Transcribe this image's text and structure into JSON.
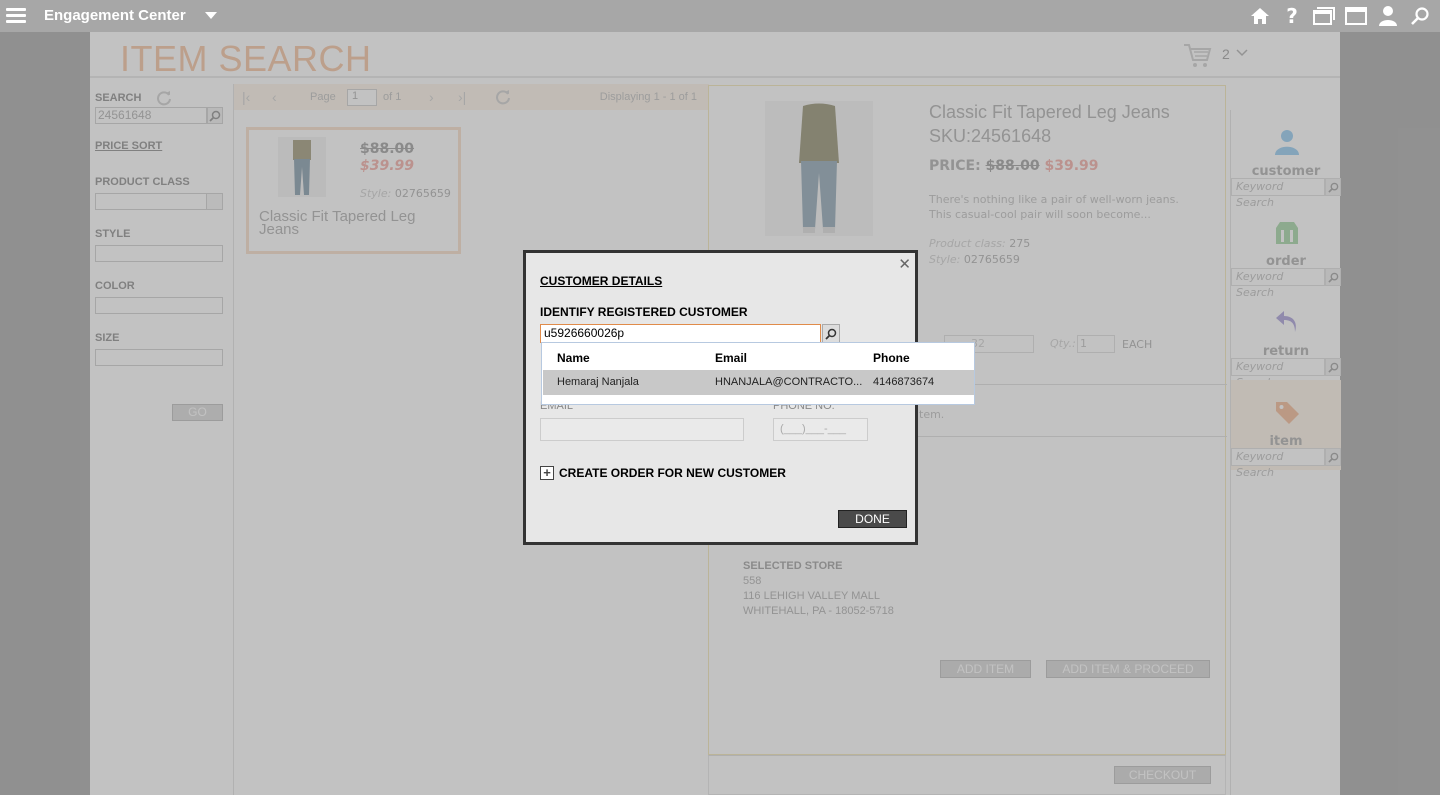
{
  "app": {
    "title": "Engagement Center"
  },
  "page": {
    "title": "ITEM SEARCH",
    "cart_count": "2"
  },
  "filters": {
    "search_label": "SEARCH",
    "search_value": "24561648",
    "price_sort": "PRICE SORT",
    "product_class_label": "PRODUCT CLASS",
    "style_label": "STYLE",
    "color_label": "COLOR",
    "size_label": "SIZE",
    "go": "GO"
  },
  "pager": {
    "page_label": "Page",
    "page_value": "1",
    "of": "of 1",
    "displaying": "Displaying 1 - 1 of 1"
  },
  "product_card": {
    "old_price": "$88.00",
    "new_price": "$39.99",
    "style_label": "Style:",
    "style_value": "02765659",
    "name": "Classic Fit Tapered Leg Jeans"
  },
  "detail": {
    "title": "Classic Fit Tapered Leg Jeans",
    "sku": "SKU:24561648",
    "price_label": "PRICE:",
    "old_price": "$88.00",
    "new_price": "$39.99",
    "description": "There's nothing like a pair of well-worn jeans. This casual-cool pair will soon become...",
    "product_class_label": "Product class:",
    "product_class_value": "275",
    "style_label": "Style:",
    "style_value": "02765659",
    "size_value": "32",
    "qty_label": "Qty.:",
    "qty_value": "1",
    "unit": "EACH",
    "ship_note": "tem.",
    "store_label": "SELECTED STORE",
    "store_number": "558",
    "store_address": "116 LEHIGH VALLEY MALL",
    "store_city": "WHITEHALL, PA - 18052-5718",
    "add_item": "ADD ITEM",
    "add_item_proceed": "ADD ITEM & PROCEED",
    "checkout": "CHECKOUT"
  },
  "right_sidebar": [
    {
      "label": "customer",
      "placeholder": "Keyword Search",
      "icon": "person-icon",
      "color": "#8fc8f0"
    },
    {
      "label": "order",
      "placeholder": "Keyword Search",
      "icon": "order-icon",
      "color": "#9fd4a0"
    },
    {
      "label": "return",
      "placeholder": "Keyword Search",
      "icon": "return-icon",
      "color": "#a59ad8"
    },
    {
      "label": "item",
      "placeholder": "Keyword Search",
      "icon": "tag-icon",
      "color": "#f3b58f"
    }
  ],
  "modal": {
    "title": "CUSTOMER DETAILS",
    "subtitle": "IDENTIFY REGISTERED CUSTOMER",
    "search_value": "u5926660026p",
    "email_label": "EMAIL",
    "phone_label": "PHONE NO.",
    "phone_placeholder": "(___)___-___",
    "create_order": "CREATE ORDER FOR NEW CUSTOMER",
    "done": "DONE"
  },
  "autocomplete": {
    "headers": {
      "name": "Name",
      "email": "Email",
      "phone": "Phone"
    },
    "rows": [
      {
        "name": "Hemaraj Nanjala",
        "email": "HNANJALA@CONTRACTO...",
        "phone": "4146873674"
      }
    ]
  }
}
